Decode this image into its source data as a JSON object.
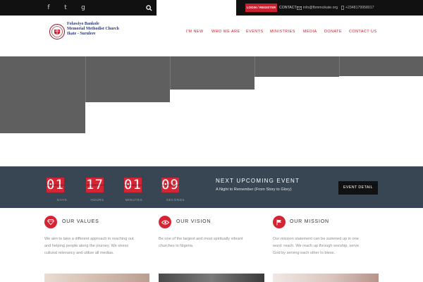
{
  "topbar": {
    "social": [
      {
        "name": "facebook",
        "glyph": "f"
      },
      {
        "name": "twitter",
        "glyph": "t"
      },
      {
        "name": "google-plus",
        "glyph": "g"
      }
    ],
    "login_label": "LOGIN / REGISTER",
    "contact_label": "CONTACT",
    "email": "info@fbmmcikate.org",
    "phone": "+2348179958017"
  },
  "header": {
    "logo_lines": [
      "Folawiyo Bankole",
      "Memorial Methodist Church",
      "Ikate - Surulere"
    ],
    "nav": [
      "I'M NEW",
      "WHO WE ARE",
      "EVENTS",
      "MINISTRIES",
      "MEDIA",
      "DONATE",
      "CONTACT US"
    ]
  },
  "countdown": {
    "days": "01",
    "hours": "17",
    "minutes": "01",
    "seconds": "09",
    "labels": [
      "DAYS",
      "HOURS",
      "MINUTES",
      "SECONDS"
    ]
  },
  "event": {
    "heading": "NEXT UPCOMING EVENT",
    "title": "A Night to Remember (From Story to Glory)",
    "button_label": "EVENT DETAIL"
  },
  "features": [
    {
      "title": "OUR VALUES",
      "lines": [
        "We aim to take a different approach in reaching out",
        "and helping people along the journey. We stress",
        "cultural relevancy and utilize all medias."
      ]
    },
    {
      "title": "OUR VISION",
      "lines": [
        "Be one of the largest and most spiritually vibrant",
        "churches in Nigeria."
      ]
    },
    {
      "title": "OUR MISSION",
      "lines": [
        "Our mission statement can be summed up in one",
        "word: reach. We reach up through worship, serve",
        "God by serving each other to bless."
      ]
    }
  ],
  "colors": {
    "accent": "#d52434",
    "band": "#374652",
    "topbar": "#111111",
    "logo_blue": "#283a7a"
  }
}
